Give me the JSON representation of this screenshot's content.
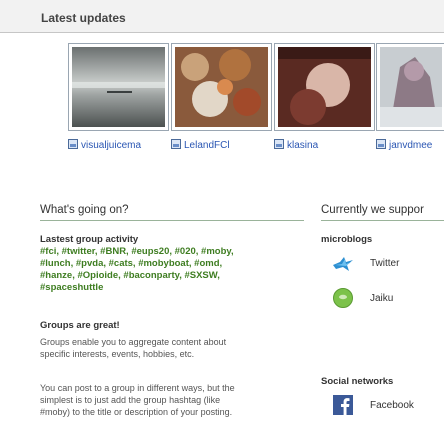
{
  "latest_updates": {
    "title": "Latest updates",
    "items": [
      {
        "user": "visualjuicema"
      },
      {
        "user": "LelandFCl"
      },
      {
        "user": "klasina"
      },
      {
        "user": "janvdmee"
      }
    ]
  },
  "whats_going_on": {
    "title": "What's going on?",
    "activity_title": "Lastest group activity",
    "activity_tags": [
      "#fci",
      "#twitter",
      "#BNR",
      "#eups20",
      "#020",
      "#moby",
      "#lunch",
      "#pvda",
      "#cats",
      "#mobyboat",
      "#omd",
      "#hanze",
      "#Opioide",
      "#baconparty",
      "#SXSW",
      "#spaceshuttle"
    ],
    "tags_lines": [
      "#fci, #twitter, #BNR, #eups20, #020, #moby,",
      "#lunch, #pvda, #cats, #mobyboat, #omd,",
      "#hanze, #Opioide, #baconparty, #SXSW,",
      "#spaceshuttle"
    ],
    "groups_title": "Groups are great!",
    "groups_text_lines": [
      "Groups enable you to aggregate content about",
      "specific interests, events, hobbies, etc."
    ],
    "post_text_lines": [
      "You can post to a group in different ways, but the",
      "simplest is to just add the group hashtag (like",
      "#moby) to the title or description of your posting."
    ]
  },
  "currently_supported": {
    "title": "Currently we suppor",
    "microblogs_title": "microblogs",
    "microblogs": [
      {
        "name": "Twitter",
        "icon": "twitter-bird-icon"
      },
      {
        "name": "Jaiku",
        "icon": "jaiku-icon"
      }
    ],
    "social_title": "Social networks",
    "social": [
      {
        "name": "Facebook",
        "icon": "facebook-icon"
      }
    ]
  },
  "colors": {
    "link": "#2a56b3",
    "tag_green": "#3e7d21",
    "header_bg": "#f2f2f2"
  }
}
